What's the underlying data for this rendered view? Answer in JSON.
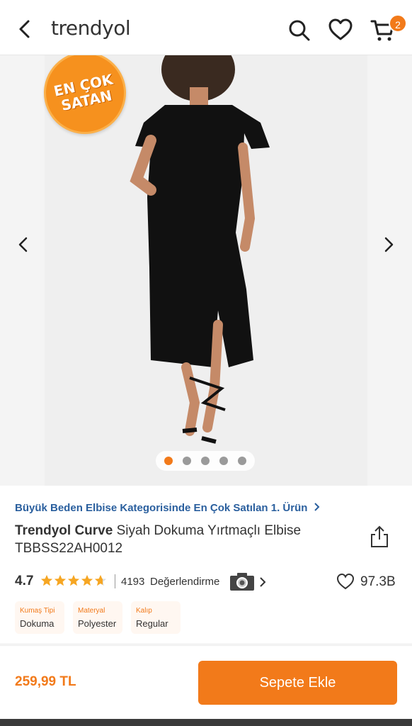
{
  "header": {
    "logo": "trendyol",
    "cart_count": "2",
    "icons": [
      "back-arrow-icon",
      "search-icon",
      "heart-icon",
      "cart-icon"
    ]
  },
  "gallery": {
    "badge_line1": "EN ÇOK",
    "badge_line2": "SATAN",
    "dots_total": 5,
    "active_dot": 1,
    "image_description": "product photo of black dress",
    "colors": {
      "accent": "#f27a1a",
      "badge": "#f6911e"
    }
  },
  "product": {
    "category_link": "Büyük Beden Elbise Kategorisinde En Çok Satılan 1. Ürün",
    "brand": "Trendyol Curve",
    "name": "Siyah Dokuma Yırtmaçlı Elbise TBBSS22AH0012",
    "rating": "4.7",
    "rating_value": 4.7,
    "review_count": "4193",
    "review_label": "Değerlendirme",
    "favorites": "97.3B",
    "attributes": [
      {
        "label": "Kumaş Tipi",
        "value": "Dokuma"
      },
      {
        "label": "Materyal",
        "value": "Polyester"
      },
      {
        "label": "Kalıp",
        "value": "Regular"
      }
    ]
  },
  "bottom": {
    "price": "259,99 TL",
    "add_to_cart": "Sepete Ekle"
  }
}
